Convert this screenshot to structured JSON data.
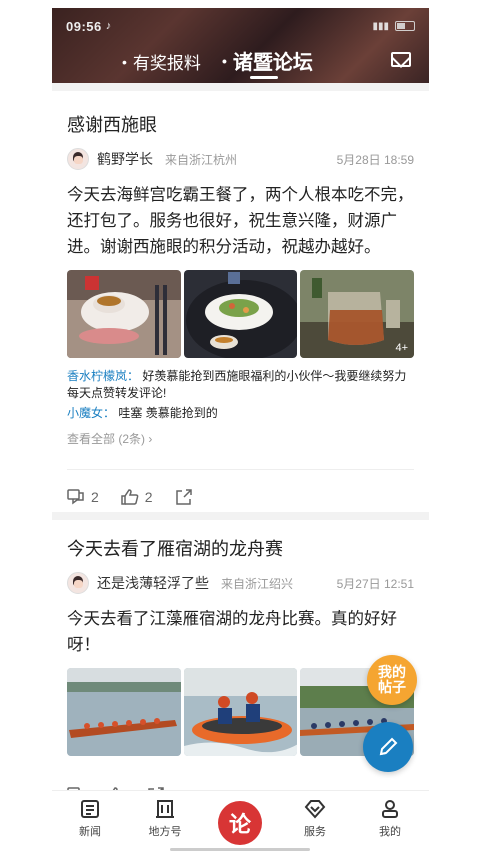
{
  "status": {
    "time": "09:56",
    "tiktok": "♪"
  },
  "header": {
    "tab1": "有奖报料",
    "tab2": "诸暨论坛"
  },
  "posts": [
    {
      "title": "感谢西施眼",
      "author": "鹤野学长",
      "from": "来自浙江杭州",
      "date": "5月28日 18:59",
      "body": "今天去海鲜宫吃霸王餐了，两个人根本吃不完，还打包了。服务也很好，祝生意兴隆，财源广进。谢谢西施眼的积分活动，祝越办越好。",
      "more_images": "4+",
      "comments": [
        {
          "name": "香水柠檬岚：",
          "text": "好羡慕能抢到西施眼福利的小伙伴～我要继续努力每天点赞转发评论!"
        },
        {
          "name": "小魔女：",
          "text": "哇塞 羡慕能抢到的"
        }
      ],
      "view_all": "查看全部 (2条) ›",
      "comment_count": "2",
      "like_count": "2"
    },
    {
      "title": "今天去看了雁宿湖的龙舟赛",
      "author": "还是浅薄轻浮了些",
      "from": "来自浙江绍兴",
      "date": "5月27日 12:51",
      "body": "今天去看了江藻雁宿湖的龙舟比赛。真的好好呀！"
    }
  ],
  "fab": {
    "my_posts": "我的帖子"
  },
  "nav": {
    "news": "新闻",
    "local": "地方号",
    "center": "论",
    "service": "服务",
    "mine": "我的"
  }
}
